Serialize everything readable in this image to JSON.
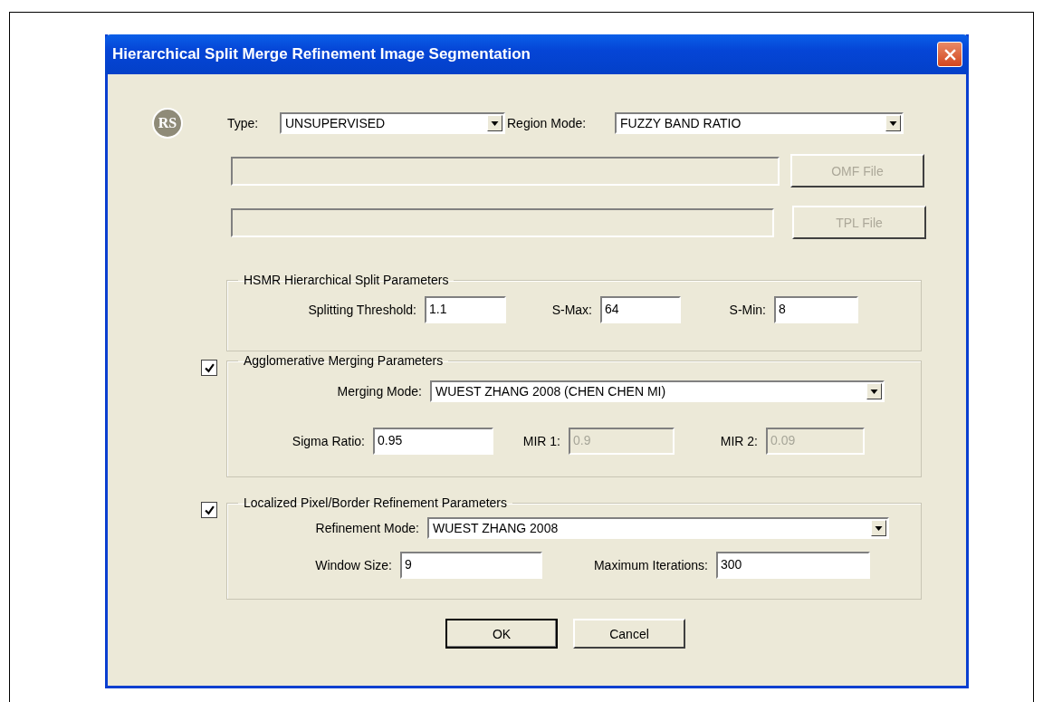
{
  "window": {
    "title": "Hierarchical Split Merge Refinement Image Segmentation"
  },
  "logo": "RS",
  "top_row": [
    {
      "label": "Type:",
      "value": "UNSUPERVISED"
    },
    {
      "label": "Region Mode:",
      "value": "FUZZY BAND RATIO"
    }
  ],
  "files": [
    {
      "disabled": true,
      "button": "OMF File"
    },
    {
      "disabled": true,
      "button": "TPL File"
    }
  ],
  "groups": [
    {
      "title": "HSMR Hierarchical Split Parameters",
      "rows": [
        [
          {
            "kind": "field",
            "label": "Splitting Threshold:",
            "value": "1.1"
          },
          {
            "kind": "field",
            "label": "S-Max:",
            "value": "64"
          },
          {
            "kind": "field",
            "label": "S-Min:",
            "value": "8"
          }
        ]
      ]
    },
    {
      "title": "Agglomerative Merging Parameters",
      "checked": true,
      "rows": [
        [
          {
            "kind": "combo",
            "label": "Merging Mode:",
            "value": "WUEST ZHANG 2008 (CHEN CHEN MI)"
          }
        ],
        [
          {
            "kind": "field",
            "label": "Sigma Ratio:",
            "value": "0.95"
          },
          {
            "kind": "field",
            "label": "MIR 1:",
            "value": "0.9",
            "disabled": true
          },
          {
            "kind": "field",
            "label": "MIR 2:",
            "value": "0.09",
            "disabled": true
          }
        ]
      ]
    },
    {
      "title": "Localized Pixel/Border Refinement Parameters",
      "checked": true,
      "rows": [
        [
          {
            "kind": "combo",
            "label": "Refinement Mode:",
            "value": "WUEST ZHANG 2008"
          }
        ],
        [
          {
            "kind": "field",
            "label": "Window Size:",
            "value": "9"
          },
          {
            "kind": "field",
            "label": "Maximum Iterations:",
            "value": "300"
          }
        ]
      ]
    }
  ],
  "buttons": [
    {
      "label": "OK",
      "default": true
    },
    {
      "label": "Cancel",
      "default": false
    }
  ]
}
